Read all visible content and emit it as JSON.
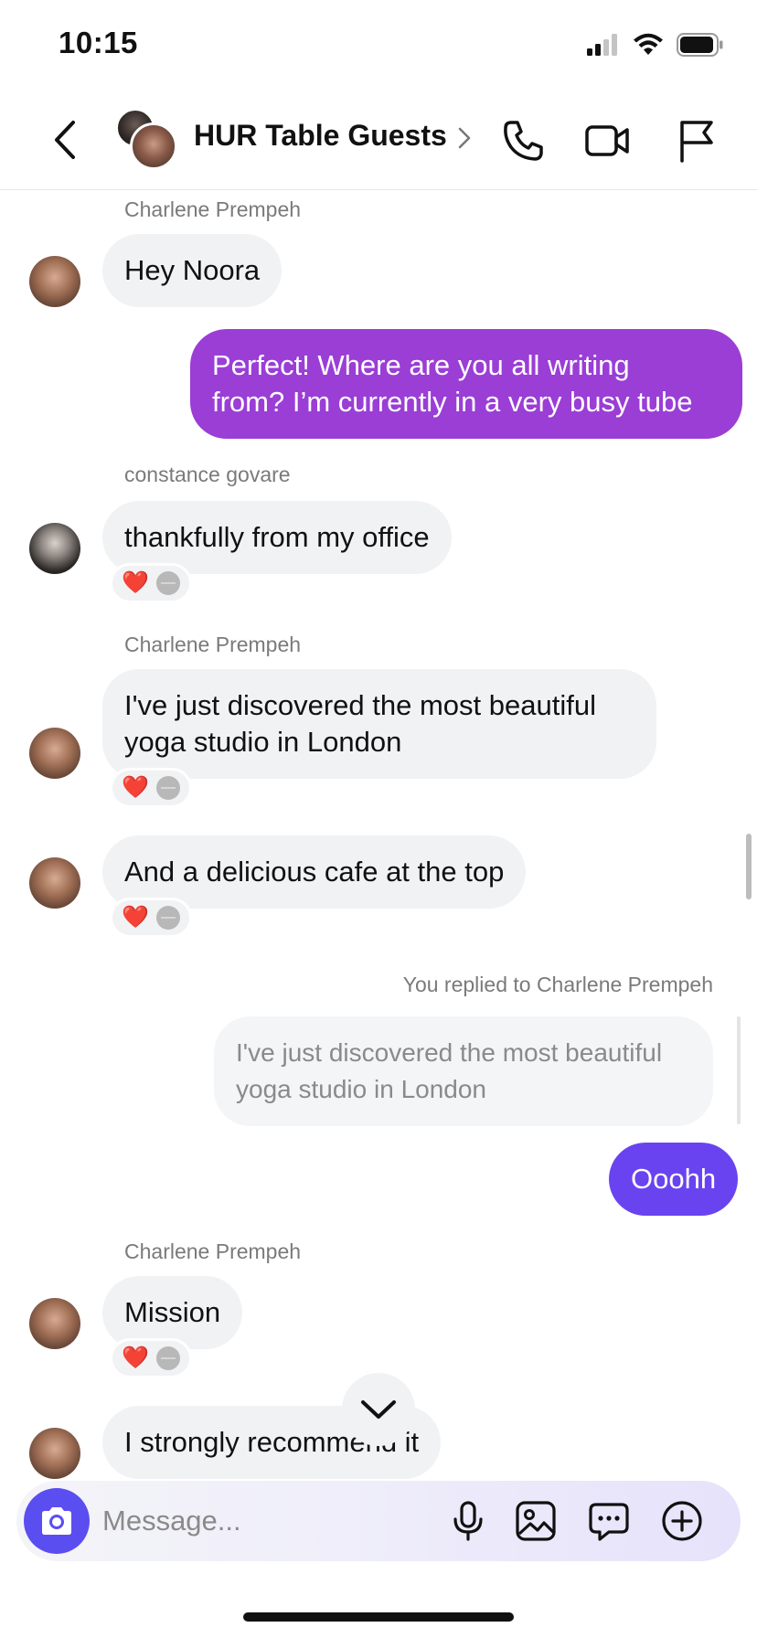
{
  "status_bar": {
    "time": "10:15"
  },
  "header": {
    "title": "HUR Table Guests"
  },
  "messages": {
    "m1": {
      "sender": "Charlene Prempeh",
      "text": "Hey Noora"
    },
    "m2": {
      "line1": "Perfect! Where are you all writing",
      "line2": "from? I’m currently in a very busy tube"
    },
    "m3": {
      "sender": "constance govare",
      "text": "thankfully from my office"
    },
    "m4": {
      "sender": "Charlene Prempeh",
      "line1": "I've just discovered the most beautiful",
      "line2": "yoga studio in London"
    },
    "m5": {
      "text": "And a delicious cafe at the top"
    },
    "m6": {
      "reply_label": "You replied to Charlene Prempeh",
      "quote_line1": "I've just discovered the most beautiful",
      "quote_line2": "yoga studio in London",
      "text": "Ooohh"
    },
    "m7": {
      "sender": "Charlene Prempeh",
      "text": "Mission"
    },
    "m8": {
      "text": "I strongly recommend it"
    }
  },
  "reaction": {
    "emoji": "❤️"
  },
  "composer": {
    "placeholder": "Message..."
  },
  "colors": {
    "outgoing_purple": "#9a3ed6",
    "outgoing_indigo": "#6a43f0",
    "incoming_bg": "#f1f2f4",
    "accent": "#5a4ef0"
  }
}
